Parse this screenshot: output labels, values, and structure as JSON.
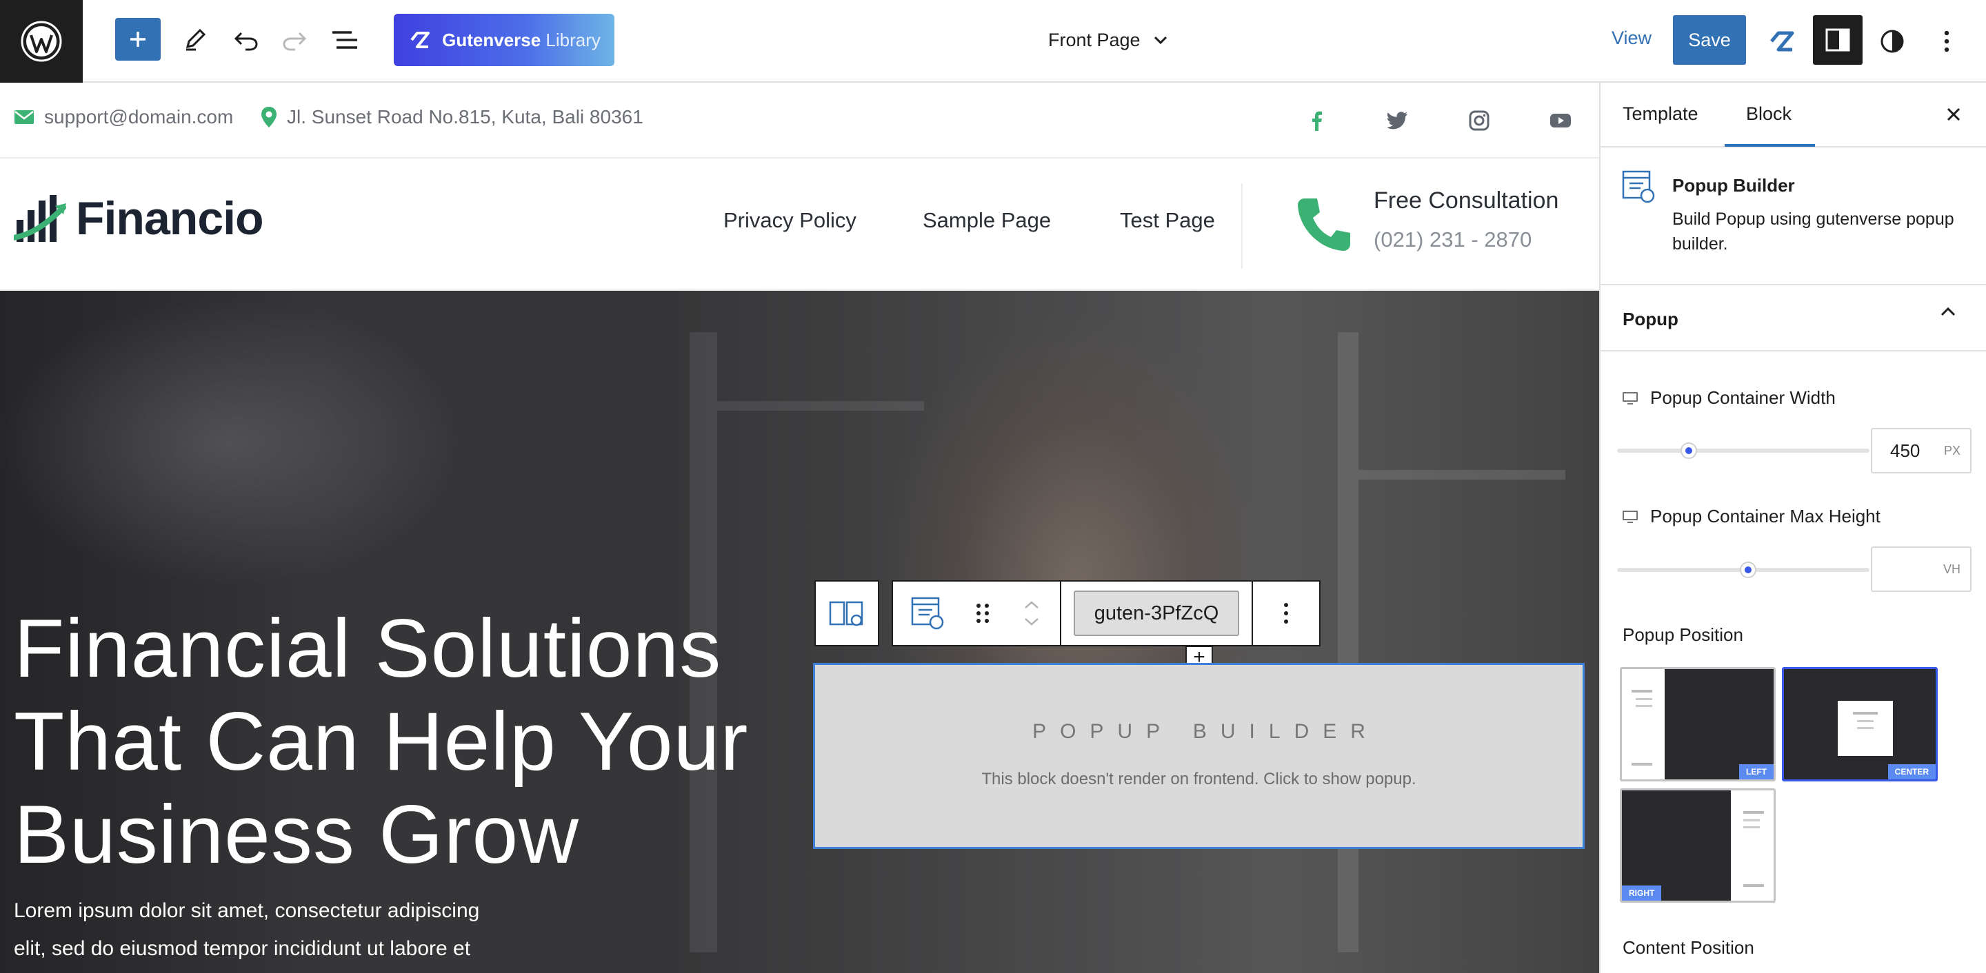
{
  "topbar": {
    "library_brand": "Gutenverse",
    "library_word": "Library",
    "document_title": "Front Page",
    "view_label": "View",
    "save_label": "Save"
  },
  "site": {
    "email": "support@domain.com",
    "address": "Jl. Sunset Road No.815, Kuta, Bali 80361",
    "brand": "Financio",
    "nav": [
      "Privacy Policy",
      "Sample Page",
      "Test Page"
    ],
    "cta_title": "Free Consultation",
    "cta_number": "(021) 231 - 2870",
    "hero_title_lines": [
      "Financial Solutions",
      "That Can Help Your",
      "Business Grow"
    ],
    "hero_text_lines": [
      "Lorem ipsum dolor sit amet, consectetur adipiscing",
      "elit, sed do eiusmod tempor incididunt ut labore et"
    ]
  },
  "block_toolbar": {
    "anchor": "guten-3PfZcQ"
  },
  "popup_block": {
    "title": "POPUP BUILDER",
    "subtitle": "This block doesn't render on frontend. Click to show popup."
  },
  "sidebar": {
    "tabs": [
      "Template",
      "Block"
    ],
    "active_tab": "Block",
    "block_name": "Popup Builder",
    "block_desc": "Build Popup using gutenverse popup builder.",
    "panel_title": "Popup",
    "width_label": "Popup Container Width",
    "width_value": "450",
    "width_unit": "PX",
    "width_fraction": 0.27,
    "height_label": "Popup Container Max Height",
    "height_value": "",
    "height_unit": "VH",
    "height_fraction": 0.52,
    "position_label": "Popup Position",
    "positions": [
      "LEFT",
      "CENTER",
      "RIGHT"
    ],
    "selected_position": "CENTER",
    "content_position_label": "Content Position"
  },
  "colors": {
    "accent": "#3171b4",
    "brand_green": "#3bb273",
    "selection": "#3858e9"
  }
}
